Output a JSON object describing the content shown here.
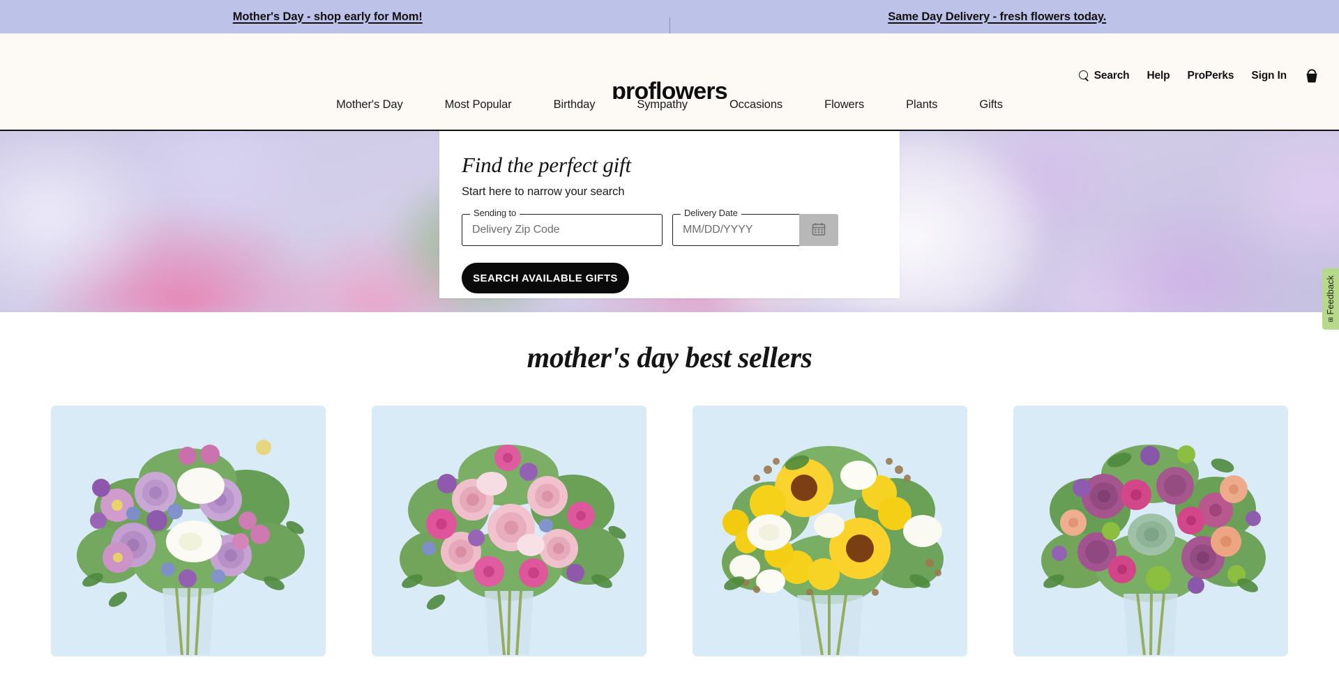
{
  "promo_banner": {
    "background_color": "#bcc2e8",
    "links": [
      {
        "label": "Mother's Day - shop early for Mom!",
        "name": "promo-link-mothers-day"
      },
      {
        "label": "Same Day Delivery - fresh flowers today.",
        "name": "promo-link-same-day"
      }
    ]
  },
  "header": {
    "logo": "proflowers",
    "background_color": "#fdfaf6",
    "utility_nav": [
      {
        "label": "Search",
        "icon": "search-icon"
      },
      {
        "label": "Help",
        "icon": null
      },
      {
        "label": "ProPerks",
        "icon": null
      },
      {
        "label": "Sign In",
        "icon": null
      }
    ],
    "cart_icon": "basket-icon"
  },
  "main_nav": {
    "items": [
      {
        "label": "Mother's Day"
      },
      {
        "label": "Most Popular"
      },
      {
        "label": "Birthday"
      },
      {
        "label": "Sympathy"
      },
      {
        "label": "Occasions"
      },
      {
        "label": "Flowers"
      },
      {
        "label": "Plants"
      },
      {
        "label": "Gifts"
      }
    ]
  },
  "hero": {
    "search_card": {
      "title": "Find the perfect gift",
      "subtitle": "Start here to narrow your search",
      "zip_field": {
        "legend": "Sending to",
        "placeholder": "Delivery Zip Code",
        "value": ""
      },
      "date_field": {
        "legend": "Delivery Date",
        "placeholder": "MM/DD/YYYY",
        "value": "",
        "calendar_icon": "calendar-icon"
      },
      "submit_label": "SEARCH AVAILABLE GIFTS",
      "submit_color": "#0a0a0a"
    }
  },
  "feedback_tab": {
    "label": "Feedback",
    "expand_glyph": "⊞",
    "color": "#b6d98a"
  },
  "best_sellers": {
    "title": "mother's day best sellers",
    "card_background": "#d9ebf7",
    "products": [
      {
        "name": "product-card-lavender-lily-bouquet",
        "palette": "lavender-roses-white-lilies"
      },
      {
        "name": "product-card-pink-rose-bouquet",
        "palette": "pink-roses-blush"
      },
      {
        "name": "product-card-sunflower-bouquet",
        "palette": "yellow-sunflowers-white-roses"
      },
      {
        "name": "product-card-purple-succulent-bouquet",
        "palette": "purple-roses-succulent-peach"
      }
    ]
  }
}
